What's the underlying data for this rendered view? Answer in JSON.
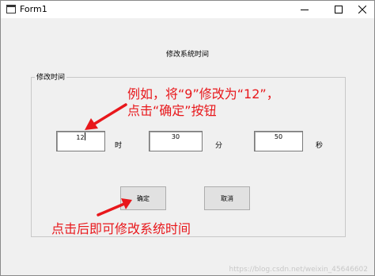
{
  "window": {
    "title": "Form1",
    "icons": [
      "app-icon",
      "minimize-icon",
      "maximize-icon",
      "close-icon"
    ]
  },
  "main_title": "修改系统时间",
  "group": {
    "caption": "修改时间",
    "hour": {
      "value": "12",
      "unit": "时"
    },
    "minute": {
      "value": "30",
      "unit": "分"
    },
    "second": {
      "value": "50",
      "unit": "秒"
    },
    "ok_label": "确定",
    "cancel_label": "取消"
  },
  "annotations": {
    "line1": "例如，将“9”修改为“12”，",
    "line2": "点击“确定”按钮",
    "line3": "点击后即可修改系统时间",
    "color": "#e8171b"
  },
  "watermark": "https://blog.csdn.net/weixin_45646602"
}
